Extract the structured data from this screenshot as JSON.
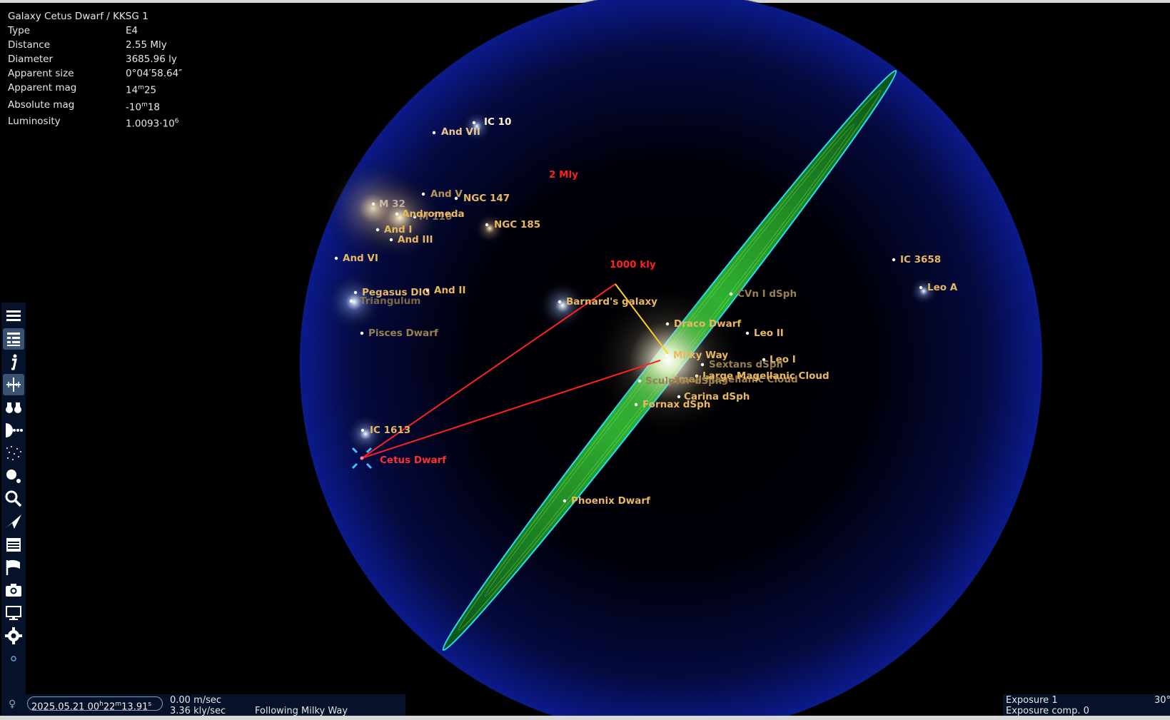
{
  "info": {
    "title": "Galaxy  Cetus Dwarf / KKSG 1",
    "rows": [
      {
        "label": "Type",
        "value": "E4"
      },
      {
        "label": "Distance",
        "value": "2.55 Mly"
      },
      {
        "label": "Diameter",
        "value": "3685.96 ly"
      },
      {
        "label": "Apparent size",
        "value": "0°04′58.64″"
      },
      {
        "label": "Apparent mag",
        "value_main": "14",
        "value_sup": "m",
        "value_rest": "25"
      },
      {
        "label": "Absolute mag",
        "value_main": "-10",
        "value_sup": "m",
        "value_rest": "18"
      },
      {
        "label": "Luminosity",
        "value_main": "1.0093·10",
        "value_sup": "6",
        "value_rest": ""
      }
    ]
  },
  "scale_labels": {
    "outer": "2 Mly",
    "inner": "1000 kly"
  },
  "galaxies": [
    {
      "name": "IC 10"
    },
    {
      "name": "And VII"
    },
    {
      "name": "M 32"
    },
    {
      "name": "And V"
    },
    {
      "name": "NGC 147"
    },
    {
      "name": "Andromeda"
    },
    {
      "name": "M 110"
    },
    {
      "name": "NGC 185"
    },
    {
      "name": "And I"
    },
    {
      "name": "And III"
    },
    {
      "name": "And VI"
    },
    {
      "name": "Pegasus DIG"
    },
    {
      "name": "Triangulum"
    },
    {
      "name": "And II"
    },
    {
      "name": "Pisces Dwarf"
    },
    {
      "name": "Barnard's galaxy"
    },
    {
      "name": "IC 3658"
    },
    {
      "name": "Leo A"
    },
    {
      "name": "CVn I dSph"
    },
    {
      "name": "Draco Dwarf"
    },
    {
      "name": "Leo II"
    },
    {
      "name": "Milky Way"
    },
    {
      "name": "Leo I"
    },
    {
      "name": "Sextans dSph"
    },
    {
      "name": "Large Magellanic Cloud"
    },
    {
      "name": "Small Magellanic Cloud"
    },
    {
      "name": "Sculptor dSph"
    },
    {
      "name": "Carina dSph"
    },
    {
      "name": "Fornax dSph"
    },
    {
      "name": "IC 1613"
    },
    {
      "name": "Phoenix Dwarf"
    }
  ],
  "selected": {
    "name": "Cetus Dwarf"
  },
  "colors": {
    "label": "#e8b860",
    "selected": "#ff3030",
    "sphere": "#0a1460",
    "disk": "#30d030",
    "ring": "#00e0ff",
    "toolbar": "#06122a"
  },
  "toolbar": {
    "items": [
      {
        "icon": "menu-icon",
        "active": false
      },
      {
        "icon": "object-list-icon",
        "active": true
      },
      {
        "icon": "info-icon",
        "active": false
      },
      {
        "icon": "distance-icon",
        "active": true
      },
      {
        "icon": "binoculars-icon",
        "active": false
      },
      {
        "icon": "planetarium-icon",
        "active": false
      },
      {
        "icon": "starfield-icon",
        "active": false
      },
      {
        "icon": "planets-icon",
        "active": false
      },
      {
        "icon": "search-icon",
        "active": false
      },
      {
        "icon": "spaceship-icon",
        "active": false
      },
      {
        "icon": "calendar-icon",
        "active": false
      },
      {
        "icon": "flag-icon",
        "active": false
      },
      {
        "icon": "camera-icon",
        "active": false
      },
      {
        "icon": "display-icon",
        "active": false
      },
      {
        "icon": "gear-icon",
        "active": false
      },
      {
        "icon": "dot-icon",
        "active": false
      }
    ]
  },
  "status": {
    "date_main": "2025.05.21 00",
    "h": "h",
    "min": "22",
    "m": "m",
    "sec": "13.91",
    "s": "s",
    "speed": "0.00 m/sec",
    "speed2": "3.36 kly/sec",
    "following": "Following Milky Way"
  },
  "exposure": {
    "line1": "Exposure 1",
    "line2": "Exposure comp. 0",
    "fov": "30°"
  }
}
